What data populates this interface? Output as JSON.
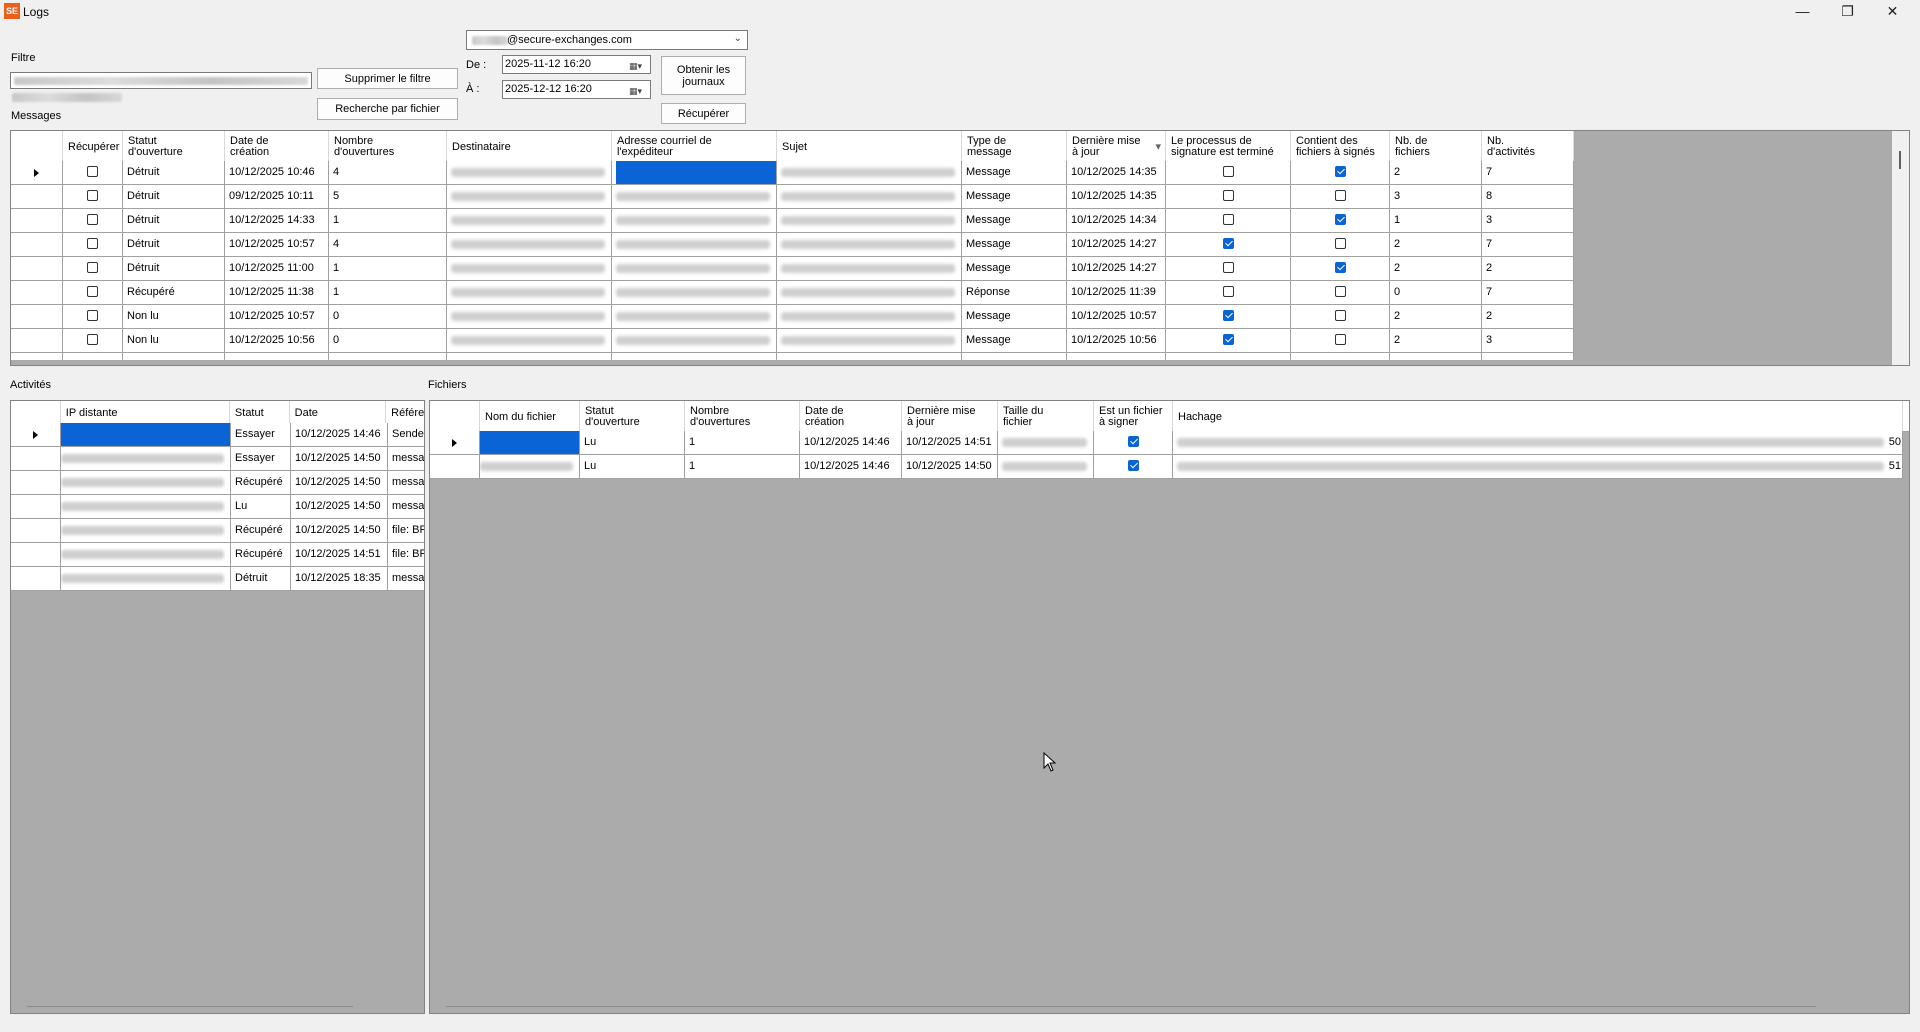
{
  "window": {
    "title": "Logs",
    "app_icon": "SE"
  },
  "filter": {
    "label": "Filtre",
    "remove_button": "Supprimer le filtre",
    "search_file_button": "Recherche par fichier"
  },
  "messages_label": "Messages",
  "account": {
    "domain": "@secure-exchanges.com"
  },
  "dates": {
    "from_label": "De :",
    "from_value": "2025-11-12 16:20",
    "to_label": "À :",
    "to_value": "2025-12-12 16:20"
  },
  "buttons": {
    "get_logs": "Obtenir les journaux",
    "recover": "Récupérer"
  },
  "messages_grid": {
    "columns": [
      "Récupérer",
      "Statut\nd'ouverture",
      "Date de\ncréation",
      "Nombre\nd'ouvertures",
      "Destinataire",
      "Adresse courriel de\nl'expéditeur",
      "Sujet",
      "Type de\nmessage",
      "Dernière mise\nà jour",
      "Le processus de\nsignature est terminé",
      "Contient des\nfichiers à signés",
      "Nb. de\nfichiers",
      "Nb.\nd'activités"
    ],
    "rows": [
      {
        "status": "Détruit",
        "created": "10/12/2025 10:46",
        "opens": "4",
        "type": "Message",
        "updated": "10/12/2025 14:35",
        "sign_done": false,
        "has_sign": true,
        "files": "2",
        "acts": "7"
      },
      {
        "status": "Détruit",
        "created": "09/12/2025 10:11",
        "opens": "5",
        "type": "Message",
        "updated": "10/12/2025 14:35",
        "sign_done": false,
        "has_sign": false,
        "files": "3",
        "acts": "8"
      },
      {
        "status": "Détruit",
        "created": "10/12/2025 14:33",
        "opens": "1",
        "type": "Message",
        "updated": "10/12/2025 14:34",
        "sign_done": false,
        "has_sign": true,
        "files": "1",
        "acts": "3"
      },
      {
        "status": "Détruit",
        "created": "10/12/2025 10:57",
        "opens": "4",
        "type": "Message",
        "updated": "10/12/2025 14:27",
        "sign_done": true,
        "has_sign": false,
        "files": "2",
        "acts": "7"
      },
      {
        "status": "Détruit",
        "created": "10/12/2025 11:00",
        "opens": "1",
        "type": "Message",
        "updated": "10/12/2025 14:27",
        "sign_done": false,
        "has_sign": true,
        "files": "2",
        "acts": "2"
      },
      {
        "status": "Récupéré",
        "created": "10/12/2025 11:38",
        "opens": "1",
        "type": "Réponse",
        "updated": "10/12/2025 11:39",
        "sign_done": false,
        "has_sign": false,
        "files": "0",
        "acts": "7"
      },
      {
        "status": "Non lu",
        "created": "10/12/2025 10:57",
        "opens": "0",
        "type": "Message",
        "updated": "10/12/2025 10:57",
        "sign_done": true,
        "has_sign": false,
        "files": "2",
        "acts": "2"
      },
      {
        "status": "Non lu",
        "created": "10/12/2025 10:56",
        "opens": "0",
        "type": "Message",
        "updated": "10/12/2025 10:56",
        "sign_done": true,
        "has_sign": false,
        "files": "2",
        "acts": "3"
      }
    ]
  },
  "activities": {
    "label": "Activités",
    "columns": [
      "IP distante",
      "Statut",
      "Date",
      "Référe"
    ],
    "rows": [
      {
        "status": "Essayer",
        "date": "10/12/2025 14:46",
        "ref": "Sender"
      },
      {
        "status": "Essayer",
        "date": "10/12/2025 14:50",
        "ref": "messag"
      },
      {
        "status": "Récupéré",
        "date": "10/12/2025 14:50",
        "ref": "messag"
      },
      {
        "status": "Lu",
        "date": "10/12/2025 14:50",
        "ref": "messag"
      },
      {
        "status": "Récupéré",
        "date": "10/12/2025 14:50",
        "ref": "file: BR"
      },
      {
        "status": "Récupéré",
        "date": "10/12/2025 14:51",
        "ref": "file: BR"
      },
      {
        "status": "Détruit",
        "date": "10/12/2025 18:35",
        "ref": "messag"
      }
    ]
  },
  "files": {
    "label": "Fichiers",
    "columns": [
      "Nom du fichier",
      "Statut\nd'ouverture",
      "Nombre\nd'ouvertures",
      "Date de\ncréation",
      "Dernière mise\nà jour",
      "Taille du\nfichier",
      "Est un fichier\nà signer",
      "Hachage"
    ],
    "rows": [
      {
        "status": "Lu",
        "opens": "1",
        "created": "10/12/2025 14:46",
        "updated": "10/12/2025 14:51",
        "to_sign": true,
        "hash_tail": "50"
      },
      {
        "status": "Lu",
        "opens": "1",
        "created": "10/12/2025 14:46",
        "updated": "10/12/2025 14:50",
        "to_sign": true,
        "hash_tail": "51"
      }
    ]
  },
  "colors": {
    "selection": "#0a64d6",
    "grid_bg": "#ababab",
    "app_icon": "#e8601c"
  }
}
